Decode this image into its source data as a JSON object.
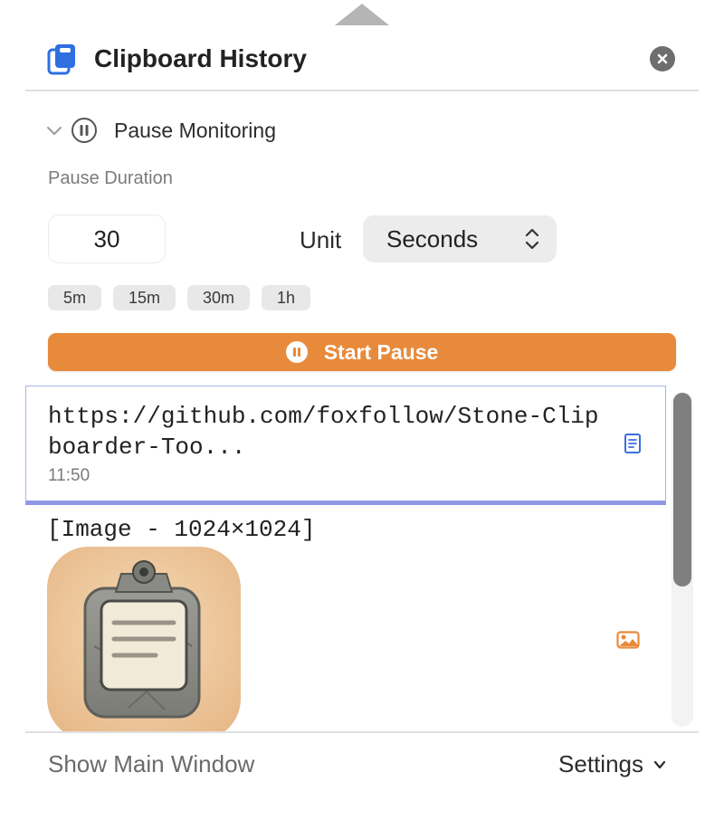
{
  "header": {
    "title": "Clipboard History",
    "app_icon": "clipboard-icon",
    "close_icon": "close-icon"
  },
  "pause": {
    "toggle_label": "Pause Monitoring",
    "duration_label": "Pause Duration",
    "duration_value": "30",
    "unit_label": "Unit",
    "unit_value": "Seconds",
    "presets": [
      "5m",
      "15m",
      "30m",
      "1h"
    ],
    "start_label": "Start Pause"
  },
  "history": {
    "items": [
      {
        "type": "text",
        "content": "https://github.com/foxfollow/Stone-Clipboarder-Too...",
        "time": "11:50",
        "icon": "document-icon"
      },
      {
        "type": "image",
        "content": "[Image - 1024×1024]",
        "icon": "image-icon"
      }
    ]
  },
  "footer": {
    "show_main": "Show Main Window",
    "settings": "Settings"
  },
  "colors": {
    "accent_orange": "#e88a3b",
    "selection_blue": "#8e98e6",
    "app_icon_blue": "#2f6fe0"
  }
}
